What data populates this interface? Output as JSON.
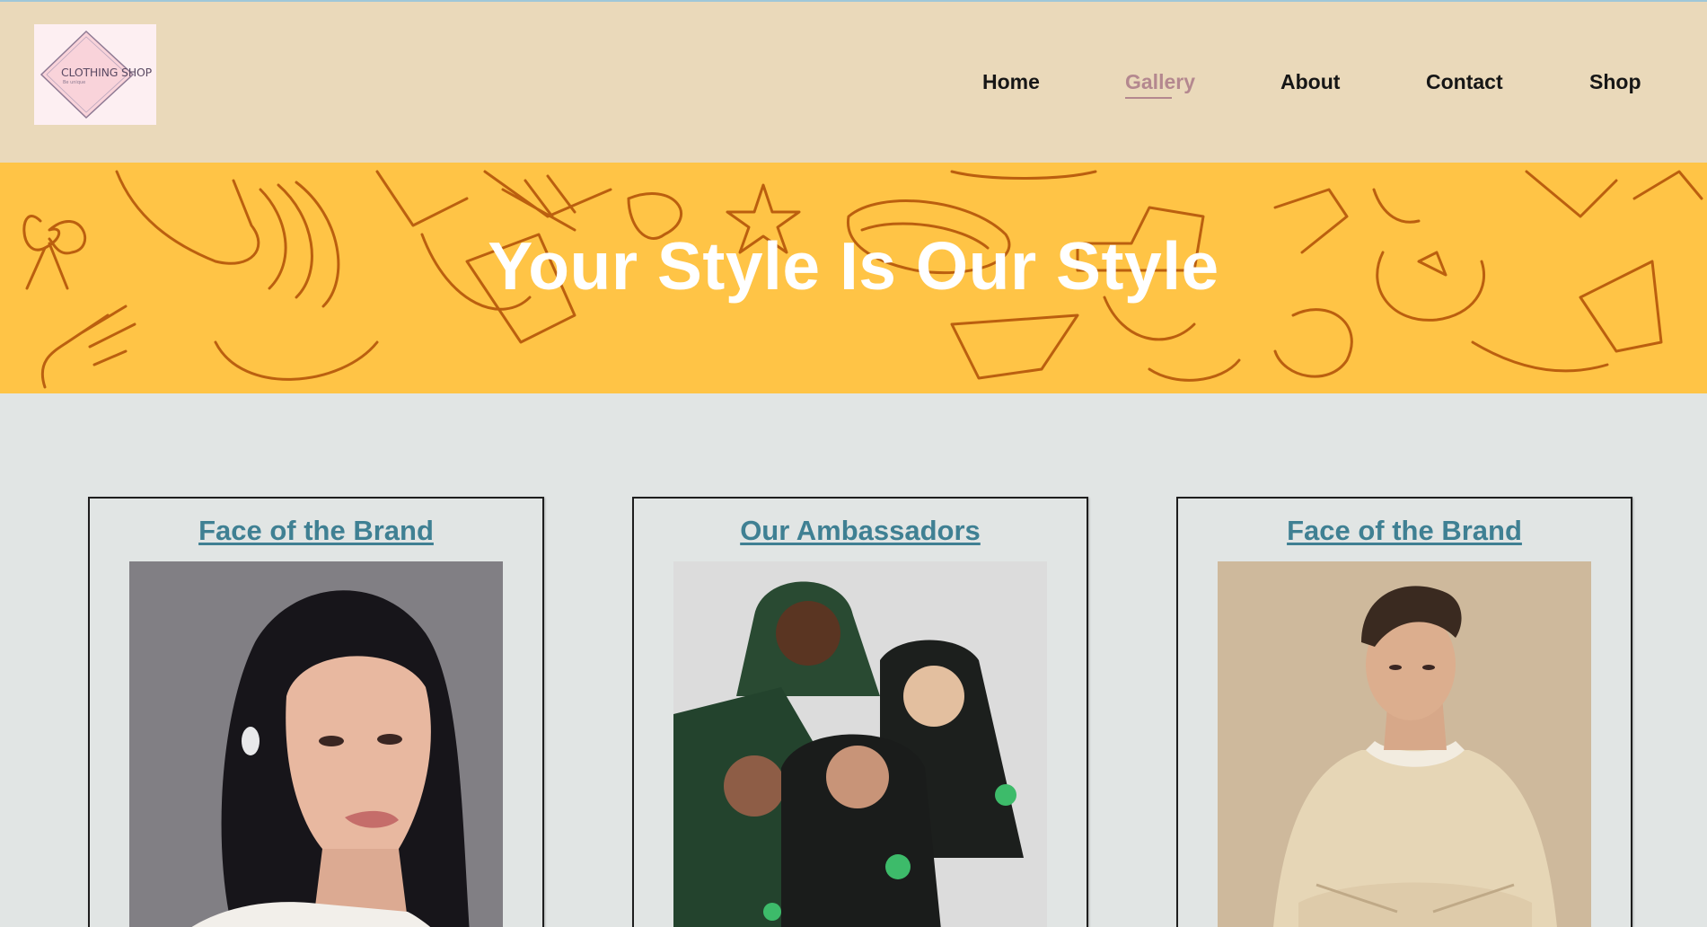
{
  "logo": {
    "text": "CLOTHING SHOP",
    "subtext": "Be unique"
  },
  "nav": {
    "items": [
      {
        "label": "Home",
        "active": false
      },
      {
        "label": "Gallery",
        "active": true
      },
      {
        "label": "About",
        "active": false
      },
      {
        "label": "Contact",
        "active": false
      },
      {
        "label": "Shop",
        "active": false
      }
    ]
  },
  "banner": {
    "title": "Your Style Is Our Style"
  },
  "gallery": {
    "cards": [
      {
        "title": "Face of the Brand",
        "photo": "woman-portrait-photo"
      },
      {
        "title": "Our Ambassadors",
        "photo": "group-hoodies-photo"
      },
      {
        "title": "Face of the Brand",
        "photo": "man-portrait-photo"
      }
    ]
  },
  "colors": {
    "header_bg": "#ead9ba",
    "banner_bg": "#ffc446",
    "page_bg": "#e1e5e4",
    "nav_active": "#b4888f",
    "card_title": "#3f8093"
  }
}
